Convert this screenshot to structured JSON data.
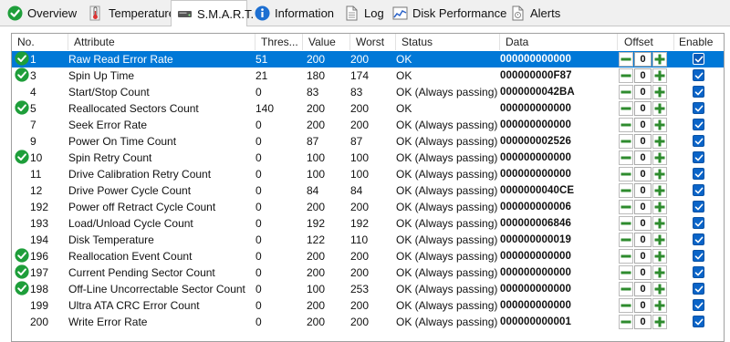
{
  "tabs": [
    {
      "label": "Overview",
      "icon": "green-check-icon"
    },
    {
      "label": "Temperature",
      "icon": "thermometer-icon"
    },
    {
      "label": "S.M.A.R.T.",
      "icon": "drive-icon",
      "active": true
    },
    {
      "label": "Information",
      "icon": "info-icon"
    },
    {
      "label": "Log",
      "icon": "log-document-icon"
    },
    {
      "label": "Disk Performance",
      "icon": "chart-icon"
    },
    {
      "label": "Alerts",
      "icon": "alerts-document-icon"
    }
  ],
  "table": {
    "columns": {
      "no": "No.",
      "attribute": "Attribute",
      "threshold": "Thres...",
      "value": "Value",
      "worst": "Worst",
      "status": "Status",
      "data": "Data",
      "offset": "Offset",
      "enable": "Enable"
    },
    "rows": [
      {
        "no": "1",
        "attribute": "Raw Read Error Rate",
        "threshold": "51",
        "value": "200",
        "worst": "200",
        "status": "OK",
        "data": "000000000000",
        "offset": "0",
        "ok_icon": true,
        "selected": true,
        "enabled": true
      },
      {
        "no": "3",
        "attribute": "Spin Up Time",
        "threshold": "21",
        "value": "180",
        "worst": "174",
        "status": "OK",
        "data": "000000000F87",
        "offset": "0",
        "ok_icon": true,
        "enabled": true
      },
      {
        "no": "4",
        "attribute": "Start/Stop Count",
        "threshold": "0",
        "value": "83",
        "worst": "83",
        "status": "OK (Always passing)",
        "data": "0000000042BA",
        "offset": "0",
        "ok_icon": false,
        "enabled": true
      },
      {
        "no": "5",
        "attribute": "Reallocated Sectors Count",
        "threshold": "140",
        "value": "200",
        "worst": "200",
        "status": "OK",
        "data": "000000000000",
        "offset": "0",
        "ok_icon": true,
        "enabled": true
      },
      {
        "no": "7",
        "attribute": "Seek Error Rate",
        "threshold": "0",
        "value": "200",
        "worst": "200",
        "status": "OK (Always passing)",
        "data": "000000000000",
        "offset": "0",
        "ok_icon": false,
        "enabled": true
      },
      {
        "no": "9",
        "attribute": "Power On Time Count",
        "threshold": "0",
        "value": "87",
        "worst": "87",
        "status": "OK (Always passing)",
        "data": "000000002526",
        "offset": "0",
        "ok_icon": false,
        "enabled": true
      },
      {
        "no": "10",
        "attribute": "Spin Retry Count",
        "threshold": "0",
        "value": "100",
        "worst": "100",
        "status": "OK (Always passing)",
        "data": "000000000000",
        "offset": "0",
        "ok_icon": true,
        "enabled": true
      },
      {
        "no": "11",
        "attribute": "Drive Calibration Retry Count",
        "threshold": "0",
        "value": "100",
        "worst": "100",
        "status": "OK (Always passing)",
        "data": "000000000000",
        "offset": "0",
        "ok_icon": false,
        "enabled": true
      },
      {
        "no": "12",
        "attribute": "Drive Power Cycle Count",
        "threshold": "0",
        "value": "84",
        "worst": "84",
        "status": "OK (Always passing)",
        "data": "0000000040CE",
        "offset": "0",
        "ok_icon": false,
        "enabled": true
      },
      {
        "no": "192",
        "attribute": "Power off Retract Cycle Count",
        "threshold": "0",
        "value": "200",
        "worst": "200",
        "status": "OK (Always passing)",
        "data": "000000000006",
        "offset": "0",
        "ok_icon": false,
        "enabled": true
      },
      {
        "no": "193",
        "attribute": "Load/Unload Cycle Count",
        "threshold": "0",
        "value": "192",
        "worst": "192",
        "status": "OK (Always passing)",
        "data": "000000006846",
        "offset": "0",
        "ok_icon": false,
        "enabled": true
      },
      {
        "no": "194",
        "attribute": "Disk Temperature",
        "threshold": "0",
        "value": "122",
        "worst": "110",
        "status": "OK (Always passing)",
        "data": "000000000019",
        "offset": "0",
        "ok_icon": false,
        "enabled": true
      },
      {
        "no": "196",
        "attribute": "Reallocation Event Count",
        "threshold": "0",
        "value": "200",
        "worst": "200",
        "status": "OK (Always passing)",
        "data": "000000000000",
        "offset": "0",
        "ok_icon": true,
        "enabled": true
      },
      {
        "no": "197",
        "attribute": "Current Pending Sector Count",
        "threshold": "0",
        "value": "200",
        "worst": "200",
        "status": "OK (Always passing)",
        "data": "000000000000",
        "offset": "0",
        "ok_icon": true,
        "enabled": true
      },
      {
        "no": "198",
        "attribute": "Off-Line Uncorrectable Sector Count",
        "threshold": "0",
        "value": "100",
        "worst": "253",
        "status": "OK (Always passing)",
        "data": "000000000000",
        "offset": "0",
        "ok_icon": true,
        "enabled": true
      },
      {
        "no": "199",
        "attribute": "Ultra ATA CRC Error Count",
        "threshold": "0",
        "value": "200",
        "worst": "200",
        "status": "OK (Always passing)",
        "data": "000000000000",
        "offset": "0",
        "ok_icon": false,
        "enabled": true
      },
      {
        "no": "200",
        "attribute": "Write Error Rate",
        "threshold": "0",
        "value": "200",
        "worst": "200",
        "status": "OK (Always passing)",
        "data": "000000000001",
        "offset": "0",
        "ok_icon": false,
        "enabled": true
      }
    ]
  },
  "colors": {
    "selection": "#0078d7",
    "ok_green": "#1e9e3a",
    "stepper_green": "#2e8b2e",
    "checkbox_blue": "#0a64c8"
  }
}
